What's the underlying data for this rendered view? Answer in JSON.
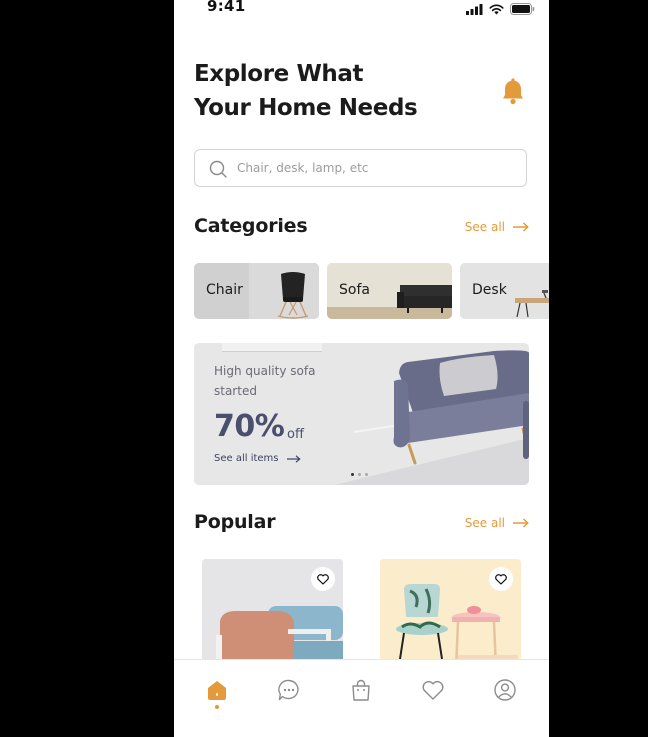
{
  "status_bar": {
    "time": "9:41"
  },
  "header": {
    "line1": "Explore What",
    "line2": "Your Home Needs"
  },
  "search": {
    "placeholder": "Chair, desk, lamp, etc",
    "value": ""
  },
  "categories": {
    "title": "Categories",
    "see_all": "See all",
    "items": [
      {
        "label": "Chair"
      },
      {
        "label": "Sofa"
      },
      {
        "label": "Desk"
      }
    ]
  },
  "banner": {
    "subtitle": "High quality sofa started",
    "discount": "70%",
    "discount_suffix": "off",
    "link": "See all items",
    "pages": 3,
    "active_page": 1
  },
  "popular": {
    "title": "Popular",
    "see_all": "See all"
  },
  "nav": {
    "items": [
      "home-icon",
      "chat-icon",
      "bag-icon",
      "heart-icon",
      "profile-icon"
    ],
    "active": "home-icon"
  },
  "colors": {
    "accent": "#e39a3b",
    "banner_text": "#4b4f6e",
    "sofa": "#6e7391"
  }
}
